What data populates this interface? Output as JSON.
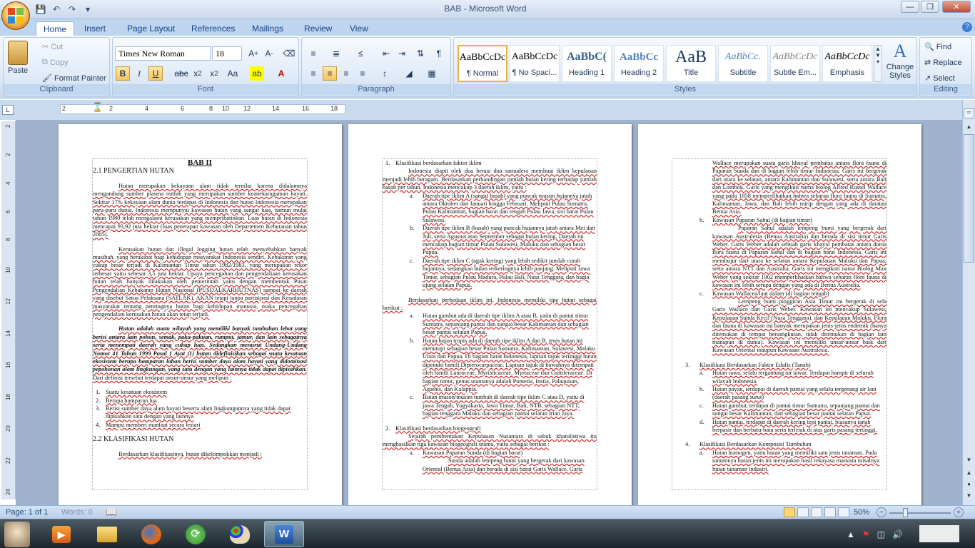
{
  "window": {
    "title": "BAB - Microsoft Word"
  },
  "qat": {
    "icons": [
      "save-icon",
      "undo-icon",
      "redo-icon",
      "customize-icon"
    ]
  },
  "tabs": [
    "Home",
    "Insert",
    "Page Layout",
    "References",
    "Mailings",
    "Review",
    "View"
  ],
  "clipboard": {
    "paste": "Paste",
    "cut": "Cut",
    "copy": "Copy",
    "format_painter": "Format Painter",
    "label": "Clipboard"
  },
  "font": {
    "family": "Times New Roman",
    "size": "18",
    "label": "Font"
  },
  "paragraph": {
    "label": "Paragraph"
  },
  "styles": {
    "label": "Styles",
    "items": [
      {
        "sample": "AaBbCcDc",
        "name": "¶ Normal"
      },
      {
        "sample": "AaBbCcDc",
        "name": "¶ No Spaci..."
      },
      {
        "sample": "AaBbC(",
        "name": "Heading 1"
      },
      {
        "sample": "AaBbCc",
        "name": "Heading 2"
      },
      {
        "sample": "AaB",
        "name": "Title"
      },
      {
        "sample": "AaBbCc.",
        "name": "Subtitle"
      },
      {
        "sample": "AaBbCcDc",
        "name": "Subtle Em..."
      },
      {
        "sample": "AaBbCcDc",
        "name": "Emphasis"
      }
    ],
    "change": "Change Styles"
  },
  "editing": {
    "find": "Find",
    "replace": "Replace",
    "select": "Select",
    "label": "Editing"
  },
  "ruler": {
    "ticks": [
      "2",
      "1",
      "2",
      "4",
      "6",
      "8",
      "10",
      "12",
      "14",
      "16",
      "18"
    ]
  },
  "vruler": {
    "ticks": [
      "2",
      "2",
      "4",
      "6",
      "8",
      "10",
      "12",
      "14",
      "16",
      "18",
      "20",
      "22",
      "24"
    ]
  },
  "page1": {
    "heading": "BAB II",
    "sec1": "2.1  PENGERTIAN HUTAN",
    "p1": "Hutan merupakan kekayaan alam tidak ternilai karena didalamnya mengandung sumber plasma nutfah yang merupakan sumber keanekaragaman hayati. Sekitar 17% kekayaan alam dunia terdapat di Indonesia dan hutan Indonesia merupakan paru-paru dunia. Indonesia mempunyai kawasan hutan yang sangat luas, namun mulai tahun 1980 telah mengalami kerusakan yang memprihatinkan. Luas hutan di Indonesia mencapai 93,92 juta hektar (luas penetapan kawasan oleh Departemen Kehutanan tahun 2005).",
    "p2": "Kerusakan hutan dan illegal logging hutan telah menyebabkan banyak musibah, yang berakibat bagi kehidupan masyarakat Indonesia sendiri. Kebakaran yang cukup besar terjadi di Kalimantan Timur tahun 1982/1983, yang merupakan rekor terbesar yaitu sebesar 3,5 juta hektar. Upaya pencegahan dan pengendaliaan kerusakan hutan telah banyak dilakukan oleh pemerintah yaitu dengan membentuk Pusat Pengendalian Kebakaran Hutan Nasional (PUSDALKARHUTNAS) sampai ke daerah yang disebut Satua Pelaksana (SATLAK), AKAN tetapi tanpa partisipasi dan Kesadaran masyarakat tentang pentingnya hutan bagi kehidupan manusia, maka pencegahan pengendalian kerusakan hutan akan tetap terjadi.",
    "p3a": "Hutan adalah suatu wilayah yang memiliki banyak tumbuhan lebat yang berisi antara lain pohon, semak, paku-pakuan, rumput, jamur, dan lain sebagainya serta menempati daerah yang cukup luas. Sedangkan menurut Undang-Undang Nomor 41 Tahun 1999 Pasal 1 Ayat (1) hutan didefinisikan sebagai suatu kesatuan ekosistem berupa hamparan lahan berisi sumber daya alam hayati yang didominasi pepohonan alam lingkungan, yang satu dengan yang lainnya tidak dapat dipisahkan.",
    "p3b": " Dari definisi tersebut terdapat unsur-unsur yang meliputi :",
    "list": [
      {
        "n": "1.",
        "t": "Suatu kesatuan ekosistem"
      },
      {
        "n": "2.",
        "t": "Berupa hamparan lua"
      },
      {
        "n": "3.",
        "t": "Berisi sumber daya alam hayati beserta alam lingkungannya yang tidak dapat dipisahkan satu dengan yang lainnya"
      },
      {
        "n": "4.",
        "t": "Mampu memberi manfaat secara lestari"
      }
    ],
    "sec2": "2.2  KLASIFIKASI HUTAN",
    "p4": "Berdasarkan klasifikasinya, hutan dikelompokkan menjadi :"
  },
  "page2": {
    "item1": "Klasifikasi berdasarkan faktor iklim",
    "p1": "Indonesia diapit oleh dua benua dua samudera membuat iklim kepulauan menjadi lebih beragam. Berdasarkan perbandingan jumlah bulan kering terhadap jumlah basah per tahun, Indonesia mencakup 3 daerah iklim, yaitu :",
    "iklim": [
      {
        "n": "a.",
        "t": "Daerah tipe iklim A (sangat basah) yang puncak musim hujannya jatuh antara Oktober dan Januari hingga Februari. Meliputi Pulau Sumatra, Pulau Kalimantan, bagian barat dan tengah Pulau Jawa, sisi barat Pulau Sulawesi."
      },
      {
        "n": "b.",
        "t": "Daerah tipe iklim B (basah) yang puncak hujannya jatuh antara Mei dan Juli, serta Agustus atau September sebagai bulan kering. Daerah ini mencakup bagian timur Pulau Sulawesi, Maluku dan sebagian besar Papua."
      },
      {
        "n": "c.",
        "t": "Daerah tipe iklim C (agak kering) yang lebih sedikit jumlah curah hujannya, sedangkan bulan terkeringnya lebih panjang. Meliputi Jawa Timur, sebagian Pulau Madura, Pulau Bali, Nusa Tenggara, dan bagia ujung selatan Papua."
      }
    ],
    "p2": "Berdasarkan perbedaan iklim ini, Indonesia memiliki tipe hutan sebagai berikut :",
    "hutan": [
      {
        "n": "a.",
        "t": "Hutan gambut ada di daerah tipe iklim A atau B, yaitu di pantai timur Sumatra, sepanjang pantai dan sungai besar Kalimantan dan sebagian besar pantai selatan Papua."
      },
      {
        "n": "b.",
        "t": "Hutan hujan tropis ada di daerah tipe iklim A dan B. jenis hutan ini menutupi sebagian besar Pulau Sumatra, Kalimantan, Sulawesi, Maluku Utara dan Papua. Di bagian barat Indonesia, lapisan tajuk tertinggi hutan dipenuhi famili Dipterocarpaceae. Lapisan tajuk di bawahnya ditempati oleh famili Lauraceae, Myristicaceae, Myrtaceae dan Guttiferaceae. Di bagian timur, genus utamanya adalah Pometia, Instia, Palaquium, Agathis, dan Kalappia."
      },
      {
        "n": "c.",
        "t": "Hutan muson/musim tumbuh di daerah tipe iklim C atau D, yaitu di jawa Tengah, Yogyakarta, Jawa Timur, Bali, NTB, sebagian NTT, bagian tenggara Maluku dan sebagian pantai selatan Irian Jaya."
      }
    ],
    "item2": "Klasifikasi berdasarkan biogeografi",
    "p3": "Sejarah pembentukan Kepulauan Nusantara di sabuk khatulistiwa itu menghasilkan tiga kawasan biogeografi utama, yaitu sebagai berikut :",
    "bio_a": "Kawasan Paparan Sunda (di bagian barat)",
    "bio_a_p": "Sunda adalah lempeng bumi yang bergerak dari kawasan Oriental (Benua Asia) dan berada di sisi barat Garis Wallace. Garis"
  },
  "page3": {
    "p0": "Wallace merupakan suatu garis khayal pembatas antara flora fauna di Paparan Sunda dan di bagian lebih timur Indonesia. Garis ini bergerak dari utara ke selatan, antara Kalimantan dan Sulawesi, serta antara Bali dan Lombok. Garis yang mengikuti nama biolog Alfred Russel Wallace yang pada 1858 memperlihatkan bahwa sebaran flora fauna di Sumatra, Kalimantan, Jawa, dan Bali lebih mirip dengan yang ada di daratan Benua Asia.",
    "bio_b": "Kawasan Paparan Sahul (di bagian timur)",
    "bio_b_p": "Paparan Sahul adalah lempeng bumi yang bergerak dari kawasan Australesia (Benua Australia) dan berada di sisi timur Garis Weber. Garis Weber adalah sebuah garis khayal pembatas antara dunia flora fauna di Paparan Sahul dan di bagian barat Indonesia. Garis ini membujur dari utara ke selatan antara Kepulauan Maluku dan Papua, serta antara NTT dan Australia. Garis ini mengikuti nama Biolog Max Weber yang sekitar 1902 memperlihatkan bahwa sebaran flora fauna di kawasan ini lebih serupa dengan yang ada di Benua Australia.",
    "bio_c": "Kawasan Wallacea/laut dalam (di bagian tengah)",
    "bio_c_p": "Lempeng bumi pinggiran Asia Timur ini bergerak di sela Garis Wallace dan Garis Weber. Kawasan ini mencakup Sulawesi, Kepulauan Sunda Kecil (Nusa Tenggara), dan Kepulauan Maluku. Flora dan fauna di kawasan ini banyak merupakan jenis-jenis endemik (hanya ditemukan di tempat bersangkutan, tidak ditemukan di bagian lain manapun di dunia). Kawasan ini memiliki unsur-unsur baik dari Kawasan Oriental maupun Kawasan Australesia.",
    "item3": "Klasifikasi  Berdasarkan Faktor Edafis (Tanah)",
    "edafis": [
      {
        "n": "a.",
        "t": "Hutan rawa, selalu tergantung air tawar. Terdapat hampir di seluruh wilayah Indonesia."
      },
      {
        "n": "b.",
        "t": "Hutan payau, terdapat di daerah pantai yang selalu tergenang air laut (daerah pasang surut)"
      },
      {
        "n": "c.",
        "t": "Hutan gambut, terdapat di pantai timur Sumatra, sepanjang pantai dan sungai besar Kalimantan, dan sebagian besar pantai selatan Papua."
      },
      {
        "n": "d.",
        "t": "Hutan pantai, terdapat di daerah kering tepi pantai, biasanya tanah berpasir dan berbatu-batu serta terletak di atas garis pasang tertinggi."
      }
    ],
    "item4": "Klasifikasi Berdasarkan Komposisi Tumbuhan",
    "komposisi_a": "Hutan homogen, yaitu hutan yang memiliki satu jenis tanaman. Pada umumnya hutan jenis ini merupakan hasil rekayasa manusia misalnya hutan tanaman industri."
  },
  "statusbar": {
    "page": "Page: 1 of 1",
    "words": "Words: 0",
    "zoom": "50%"
  },
  "taskbar": {
    "icons": [
      "user-avatar-icon",
      "media-player-icon",
      "file-explorer-icon",
      "firefox-icon",
      "refresh-app-icon",
      "paint-icon",
      "word-icon"
    ]
  }
}
